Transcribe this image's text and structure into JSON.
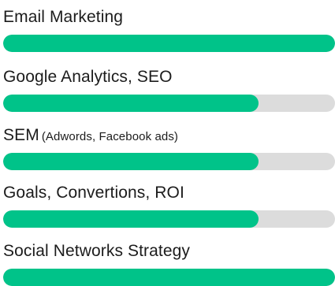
{
  "skills": [
    {
      "label": "Email Marketing",
      "sublabel": "",
      "level": 1.0
    },
    {
      "label": "Google Analytics, SEO",
      "sublabel": "",
      "level": 0.77
    },
    {
      "label": "SEM",
      "sublabel": "(Adwords, Facebook ads)",
      "level": 0.77
    },
    {
      "label": "Goals, Convertions, ROI",
      "sublabel": "",
      "level": 0.77
    },
    {
      "label": "Social Networks Strategy",
      "sublabel": "",
      "level": 1.0
    }
  ],
  "colors": {
    "fill": "#00c389",
    "track": "#dcdcdc",
    "text": "#1c1c1c"
  }
}
